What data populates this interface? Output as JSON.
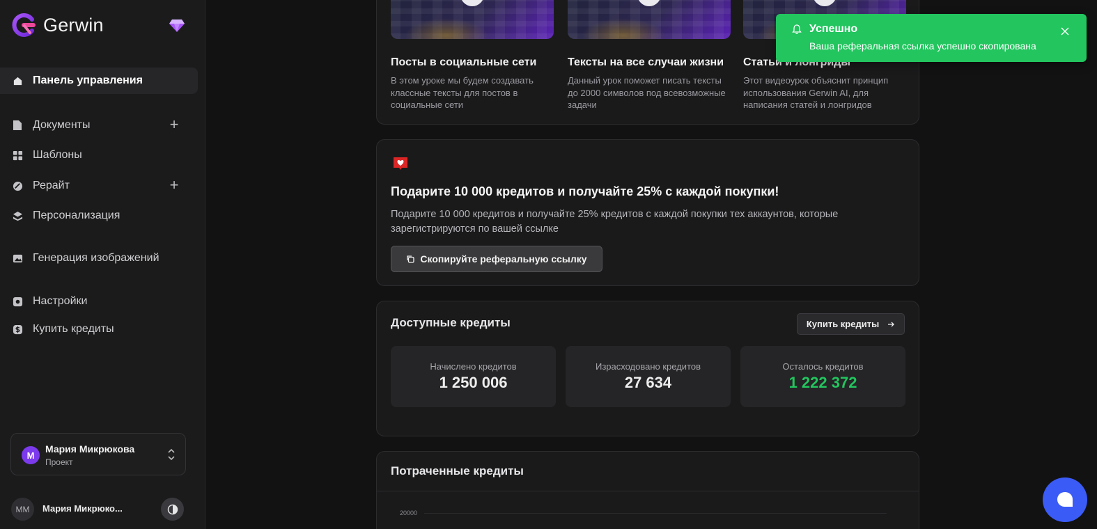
{
  "app": {
    "name": "Gerwin"
  },
  "sidebar": {
    "items": [
      {
        "label": "Панель управления",
        "icon": "home-icon",
        "active": true
      },
      {
        "label": "Документы",
        "icon": "document-icon",
        "plus": true
      },
      {
        "label": "Шаблоны",
        "icon": "templates-icon"
      },
      {
        "label": "Рерайт",
        "icon": "rewrite-icon",
        "plus": true
      },
      {
        "label": "Персонализация",
        "icon": "personalization-icon"
      },
      {
        "label": "Генерация изображений",
        "icon": "image-icon"
      },
      {
        "label": "Настройки",
        "icon": "settings-icon"
      },
      {
        "label": "Купить кредиты",
        "icon": "credits-icon"
      }
    ],
    "project": {
      "avatar": "M",
      "name": "Мария Микрюкова",
      "subtitle": "Проект"
    },
    "user": {
      "initials": "MM",
      "name": "Мария Микрюко..."
    }
  },
  "lessons": [
    {
      "title": "Посты в социальные сети",
      "description": "В этом уроке мы будем создавать классные тексты для постов в социальные сети"
    },
    {
      "title": "Тексты на все случаи жизни",
      "description": "Данный урок поможет писать тексты до 2000 символов под всевозможные задачи"
    },
    {
      "title": "Статьи и лонгриды",
      "description": "Этот видеоурок объяснит принцип использования Gerwin AI, для написания статей и лонгридов"
    }
  ],
  "referral": {
    "title": "Подарите 10 000 кредитов и получайте 25% с каждой покупки!",
    "description": "Подарите 10 000 кредитов и получайте 25% кредитов с каждой покупки тех аккаунтов, которые зарегистрируются по вашей ссылке",
    "button": "Скопируйте реферальную ссылку"
  },
  "credits": {
    "title": "Доступные кредиты",
    "buy_button": "Купить кредиты",
    "stats": [
      {
        "label": "Начислено кредитов",
        "value": "1 250 006"
      },
      {
        "label": "Израсходовано кредитов",
        "value": "27 634"
      },
      {
        "label": "Осталось кредитов",
        "value": "1 222 372",
        "color": "#22c55e"
      }
    ]
  },
  "spent": {
    "title": "Потраченные кредиты",
    "ytick_top": "20000"
  },
  "toast": {
    "title": "Успешно",
    "message": "Ваша реферальная ссылка успешно скопирована",
    "color": "#22c55e"
  },
  "colors": {
    "accent": "#7c3aed",
    "chat": "#3b5bf6"
  }
}
